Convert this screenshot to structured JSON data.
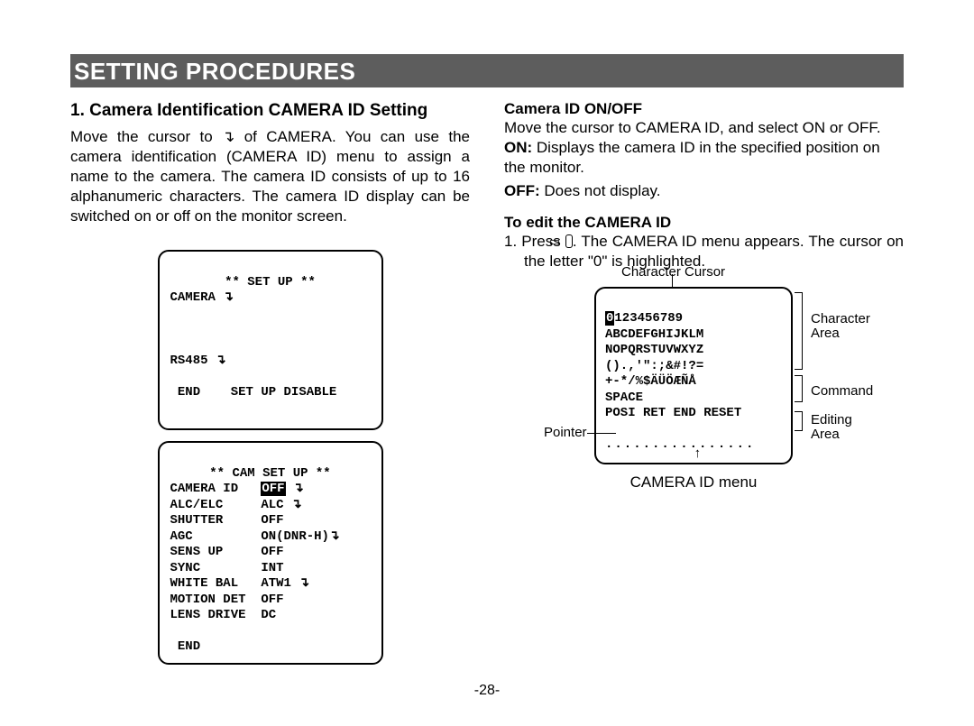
{
  "banner": "SETTING PROCEDURES",
  "left": {
    "heading": "1. Camera Identification CAMERA ID Setting",
    "para": "Move the cursor to ↴ of CAMERA. You can use the camera identification (CAMERA ID) menu to assign a name to the camera. The camera ID consists of up to 16 alphanumeric characters. The camera ID display can be switched on or off on the monitor screen.",
    "menu1": {
      "title": "** SET UP **",
      "l1": "CAMERA ↴",
      "l2": "RS485 ↴",
      "l3": " END    SET UP DISABLE"
    },
    "menu2": {
      "title": "** CAM SET UP **",
      "rows": [
        [
          "CAMERA ID",
          "OFF ↴",
          true
        ],
        [
          "ALC/ELC",
          "ALC ↴",
          false
        ],
        [
          "SHUTTER",
          "OFF",
          false
        ],
        [
          "AGC",
          "ON(DNR-H)↴",
          false
        ],
        [
          "SENS UP",
          "OFF",
          false
        ],
        [
          "SYNC",
          "INT",
          false
        ],
        [
          "WHITE BAL",
          "ATW1 ↴",
          false
        ],
        [
          "MOTION DET",
          "OFF",
          false
        ],
        [
          "LENS DRIVE",
          "DC",
          false
        ]
      ],
      "end": " END"
    }
  },
  "right": {
    "h1": "Camera ID ON/OFF",
    "p1": "Move the cursor to CAMERA ID, and select ON or OFF.",
    "p2a": "ON:",
    "p2b": " Displays the camera ID in the specified position on the monitor.",
    "p3a": "OFF:",
    "p3b": " Does not display.",
    "h2": "To edit the CAMERA ID",
    "p4": "1. Press ▭. The CAMERA ID menu appears. The cursor on the letter \"0\" is highlighted.",
    "labels": {
      "top": "Character Cursor",
      "chararea": "Character\nArea",
      "command": "Command",
      "editarea": "Editing\nArea",
      "pointer": "Pointer"
    },
    "menu3": {
      "r1": "0123456789",
      "r2": "ABCDEFGHIJKLM",
      "r3": "NOPQRSTUVWXYZ",
      "r4": "().,'\":;&#!?=",
      "r5": "+-*/%$ÄÜÖÆÑÅ",
      "r6": "SPACE",
      "r7": "POSI RET END RESET",
      "r8": "................"
    },
    "caption": "CAMERA ID menu"
  },
  "pagenum": "-28-"
}
